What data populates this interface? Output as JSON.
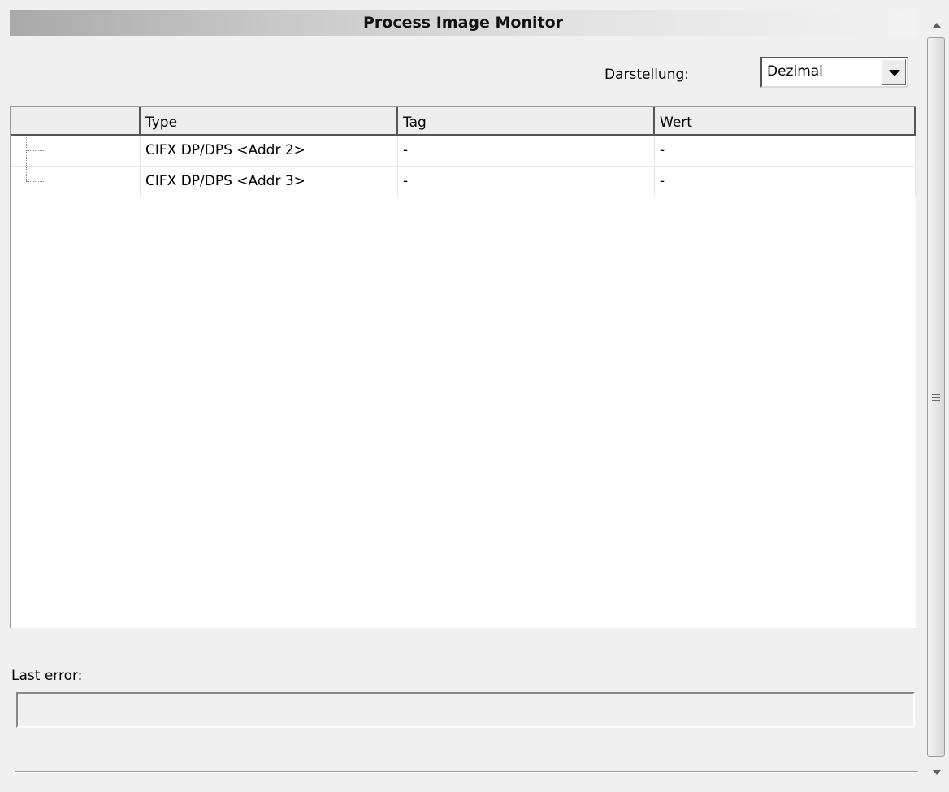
{
  "window": {
    "title": "Process Image Monitor"
  },
  "display": {
    "label": "Darstellung:",
    "selected": "Dezimal"
  },
  "table": {
    "columns": [
      "",
      "Type",
      "Tag",
      "Wert"
    ],
    "rows": [
      {
        "type": "CIFX DP/DPS <Addr 2>",
        "tag": "-",
        "wert": "-"
      },
      {
        "type": "CIFX DP/DPS <Addr 3>",
        "tag": "-",
        "wert": "-"
      }
    ]
  },
  "status": {
    "last_error_label": "Last error:",
    "last_error_value": ""
  },
  "scrollbar": {
    "up_icon": "arrow-up-icon",
    "down_icon": "arrow-down-icon",
    "grip_icon": "grip-icon"
  }
}
